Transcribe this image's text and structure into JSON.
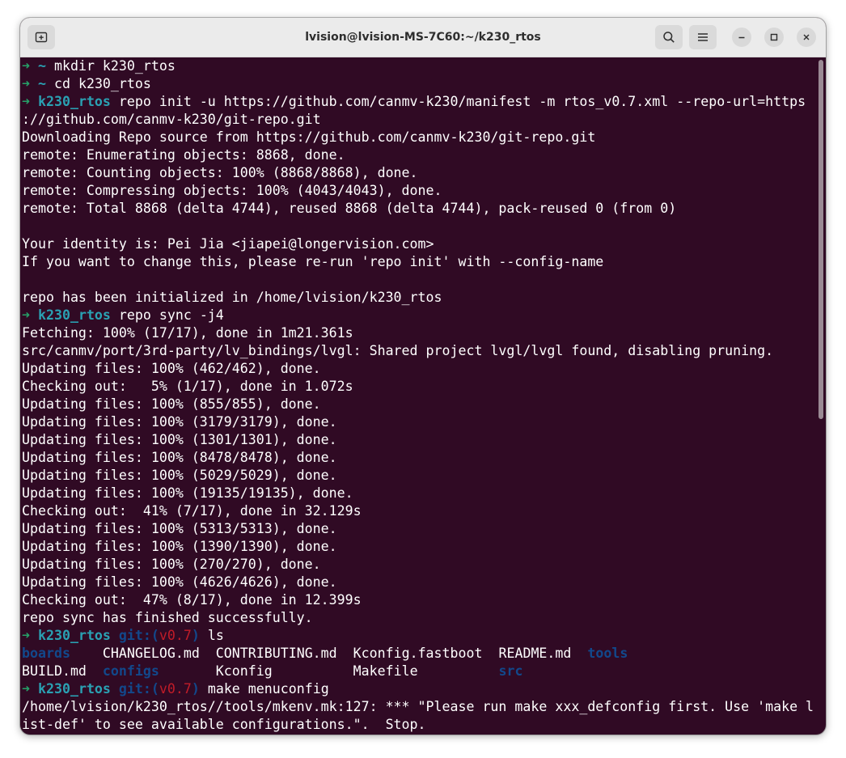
{
  "window": {
    "title": "lvision@lvision-MS-7C60:~/k230_rtos"
  },
  "icons": {
    "new_tab": "new-tab-icon",
    "search": "search-icon",
    "menu": "hamburger-menu-icon",
    "minimize": "minimize-icon",
    "maximize": "maximize-icon",
    "close": "close-icon"
  },
  "colors": {
    "terminal_bg": "#300a24",
    "prompt_arrow": "#26a269",
    "prompt_dir": "#2aa1b3",
    "git_label": "#12488b",
    "git_branch": "#c01c28"
  },
  "prompts": {
    "arrow": "➜",
    "home": "~",
    "dir": "k230_rtos",
    "git_open": "git:(",
    "branch": "v0.7",
    "git_close": ")"
  },
  "terminal": {
    "cmd_mkdir": " mkdir k230_rtos",
    "cmd_cd": " cd k230_rtos",
    "cmd_repo_init": " repo init -u https://github.com/canmv-k230/manifest -m rtos_v0.7.xml --repo-url=https",
    "out_01": "://github.com/canmv-k230/git-repo.git",
    "out_02": "Downloading Repo source from https://github.com/canmv-k230/git-repo.git",
    "out_03": "remote: Enumerating objects: 8868, done.",
    "out_04": "remote: Counting objects: 100% (8868/8868), done.",
    "out_05": "remote: Compressing objects: 100% (4043/4043), done.",
    "out_06": "remote: Total 8868 (delta 4744), reused 8868 (delta 4744), pack-reused 0 (from 0)",
    "out_07": "Your identity is: Pei Jia <jiapei@longervision.com>",
    "out_08": "If you want to change this, please re-run 'repo init' with --config-name",
    "out_09": "repo has been initialized in /home/lvision/k230_rtos",
    "cmd_repo_sync": " repo sync -j4",
    "out_10": "Fetching: 100% (17/17), done in 1m21.361s",
    "out_11": "src/canmv/port/3rd-party/lv_bindings/lvgl: Shared project lvgl/lvgl found, disabling pruning.",
    "out_12": "Updating files: 100% (462/462), done.",
    "out_13": "Checking out:   5% (1/17), done in 1.072s",
    "out_14": "Updating files: 100% (855/855), done.",
    "out_15": "Updating files: 100% (3179/3179), done.",
    "out_16": "Updating files: 100% (1301/1301), done.",
    "out_17": "Updating files: 100% (8478/8478), done.",
    "out_18": "Updating files: 100% (5029/5029), done.",
    "out_19": "Updating files: 100% (19135/19135), done.",
    "out_20": "Checking out:  41% (7/17), done in 32.129s",
    "out_21": "Updating files: 100% (5313/5313), done.",
    "out_22": "Updating files: 100% (1390/1390), done.",
    "out_23": "Updating files: 100% (270/270), done.",
    "out_24": "Updating files: 100% (4626/4626), done.",
    "out_25": "Checking out:  47% (8/17), done in 12.399s",
    "out_26": "repo sync has finished successfully.",
    "cmd_ls": " ls",
    "ls_boards": "boards",
    "ls_changelog": "CHANGELOG.md",
    "ls_contributing": "CONTRIBUTING.md",
    "ls_kconfig_fastboot": "Kconfig.fastboot",
    "ls_readme": "README.md",
    "ls_tools": "tools",
    "ls_build": "BUILD.md",
    "ls_configs": "configs",
    "ls_kconfig": "Kconfig",
    "ls_makefile": "Makefile",
    "ls_src": "src",
    "cmd_menuconfig": " make menuconfig",
    "out_27": "/home/lvision/k230_rtos//tools/mkenv.mk:127: *** \"Please run make xxx_defconfig first. Use 'make l",
    "out_28": "ist-def' to see available configurations.\".  Stop."
  }
}
